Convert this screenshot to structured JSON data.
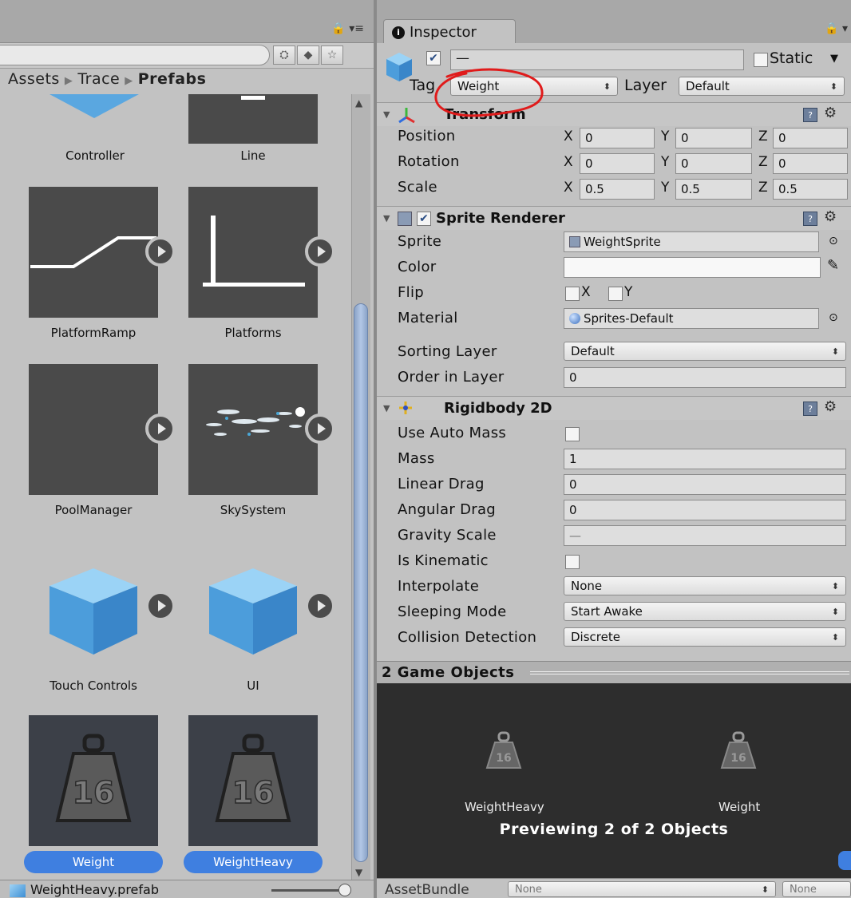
{
  "project": {
    "breadcrumb": {
      "root": "Assets",
      "mid": "Trace",
      "current": "Prefabs"
    },
    "tiles": [
      {
        "label": "Controller"
      },
      {
        "label": "Line"
      },
      {
        "label": "PlatformRamp"
      },
      {
        "label": "Platforms"
      },
      {
        "label": "PoolManager"
      },
      {
        "label": "SkySystem"
      },
      {
        "label": "Touch Controls"
      },
      {
        "label": "UI"
      },
      {
        "label": "Weight",
        "selected": true
      },
      {
        "label": "WeightHeavy",
        "selected": true
      }
    ],
    "weight_badge": "16",
    "status_file": "WeightHeavy.prefab"
  },
  "inspector": {
    "tab_label": "Inspector",
    "static_label": "Static",
    "name_value": "—",
    "tag": {
      "label": "Tag",
      "value": "Weight"
    },
    "layer": {
      "label": "Layer",
      "value": "Default"
    },
    "transform": {
      "title": "Transform",
      "position": {
        "label": "Position",
        "x": "0",
        "y": "0",
        "z": "0"
      },
      "rotation": {
        "label": "Rotation",
        "x": "0",
        "y": "0",
        "z": "0"
      },
      "scale": {
        "label": "Scale",
        "x": "0.5",
        "y": "0.5",
        "z": "0.5"
      },
      "axes": {
        "x": "X",
        "y": "Y",
        "z": "Z"
      }
    },
    "sprite_renderer": {
      "title": "Sprite Renderer",
      "sprite": {
        "label": "Sprite",
        "value": "WeightSprite"
      },
      "color": {
        "label": "Color"
      },
      "flip": {
        "label": "Flip",
        "x": "X",
        "y": "Y"
      },
      "material": {
        "label": "Material",
        "value": "Sprites-Default"
      },
      "sorting_layer": {
        "label": "Sorting Layer",
        "value": "Default"
      },
      "order_in_layer": {
        "label": "Order in Layer",
        "value": "0"
      }
    },
    "rigidbody2d": {
      "title": "Rigidbody 2D",
      "use_auto_mass": {
        "label": "Use Auto Mass"
      },
      "mass": {
        "label": "Mass",
        "value": "1"
      },
      "linear_drag": {
        "label": "Linear Drag",
        "value": "0"
      },
      "angular_drag": {
        "label": "Angular Drag",
        "value": "0"
      },
      "gravity_scale": {
        "label": "Gravity Scale",
        "value": "—"
      },
      "is_kinematic": {
        "label": "Is Kinematic"
      },
      "interpolate": {
        "label": "Interpolate",
        "value": "None"
      },
      "sleeping_mode": {
        "label": "Sleeping Mode",
        "value": "Start Awake"
      },
      "collision_detection": {
        "label": "Collision Detection",
        "value": "Discrete"
      }
    },
    "selection": {
      "title": "2 Game Objects",
      "items": [
        "WeightHeavy",
        "Weight"
      ],
      "caption": "Previewing 2 of 2 Objects"
    },
    "assetbundle": {
      "label": "AssetBundle",
      "value": "None",
      "variant": "None"
    }
  },
  "colors": {
    "selection_blue": "#3f7fe0",
    "annotation_red": "#e01b1b",
    "preview_bg": "#2d2d2d"
  }
}
